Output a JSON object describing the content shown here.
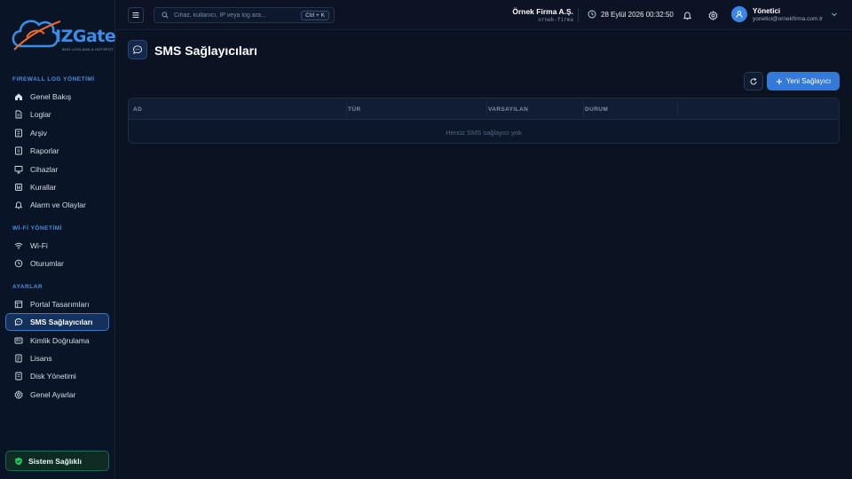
{
  "brand": {
    "logo_text": "IZGate",
    "logo_sub": "5651 LOGLAMA & HOTSPOT"
  },
  "sidebar": {
    "sections": [
      {
        "title": "FIREWALL LOG YÖNETİMİ",
        "items": [
          {
            "label": "Genel Bakış",
            "icon": "home-icon"
          },
          {
            "label": "Loglar",
            "icon": "file-icon"
          },
          {
            "label": "Arşiv",
            "icon": "archive-icon"
          },
          {
            "label": "Raporlar",
            "icon": "report-icon"
          },
          {
            "label": "Cihazlar",
            "icon": "monitor-icon"
          },
          {
            "label": "Kurallar",
            "icon": "rules-icon"
          },
          {
            "label": "Alarm ve Olaylar",
            "icon": "bell-icon"
          }
        ]
      },
      {
        "title": "Wİ-Fİ YÖNETİMİ",
        "items": [
          {
            "label": "Wi-Fi",
            "icon": "wifi-icon"
          },
          {
            "label": "Oturumlar",
            "icon": "clock-icon"
          }
        ]
      },
      {
        "title": "AYARLAR",
        "items": [
          {
            "label": "Portal Tasarımları",
            "icon": "layout-icon"
          },
          {
            "label": "SMS Sağlayıcıları",
            "icon": "message-icon",
            "active": true
          },
          {
            "label": "Kimlik Doğrulama",
            "icon": "id-card-icon"
          },
          {
            "label": "Lisans",
            "icon": "license-icon"
          },
          {
            "label": "Disk Yönetimi",
            "icon": "disk-icon"
          },
          {
            "label": "Genel Ayarlar",
            "icon": "gear-icon"
          }
        ]
      }
    ],
    "health_label": "Sistem Sağlıklı"
  },
  "topbar": {
    "search_placeholder": "Cihaz, kullanıcı, IP veya log ara...",
    "shortcut": "Ctrl + K",
    "company_name": "Örnek Firma A.Ş.",
    "company_slug": "ornek-firma",
    "datetime": "28 Eylül 2026 00:32:50",
    "user_name": "Yönetici",
    "user_email": "yonetici@ornekfirma.com.tr"
  },
  "main": {
    "title": "SMS Sağlayıcıları",
    "new_button": "Yeni Sağlayıcı",
    "columns": [
      "AD",
      "TÜR",
      "VARSAYILAN",
      "DURUM"
    ],
    "empty_text": "Henüz SMS sağlayıcı yok"
  },
  "colors": {
    "accent": "#3478d8",
    "background": "#0b1222",
    "sidebar": "#0a1427",
    "success": "#22c55e"
  }
}
